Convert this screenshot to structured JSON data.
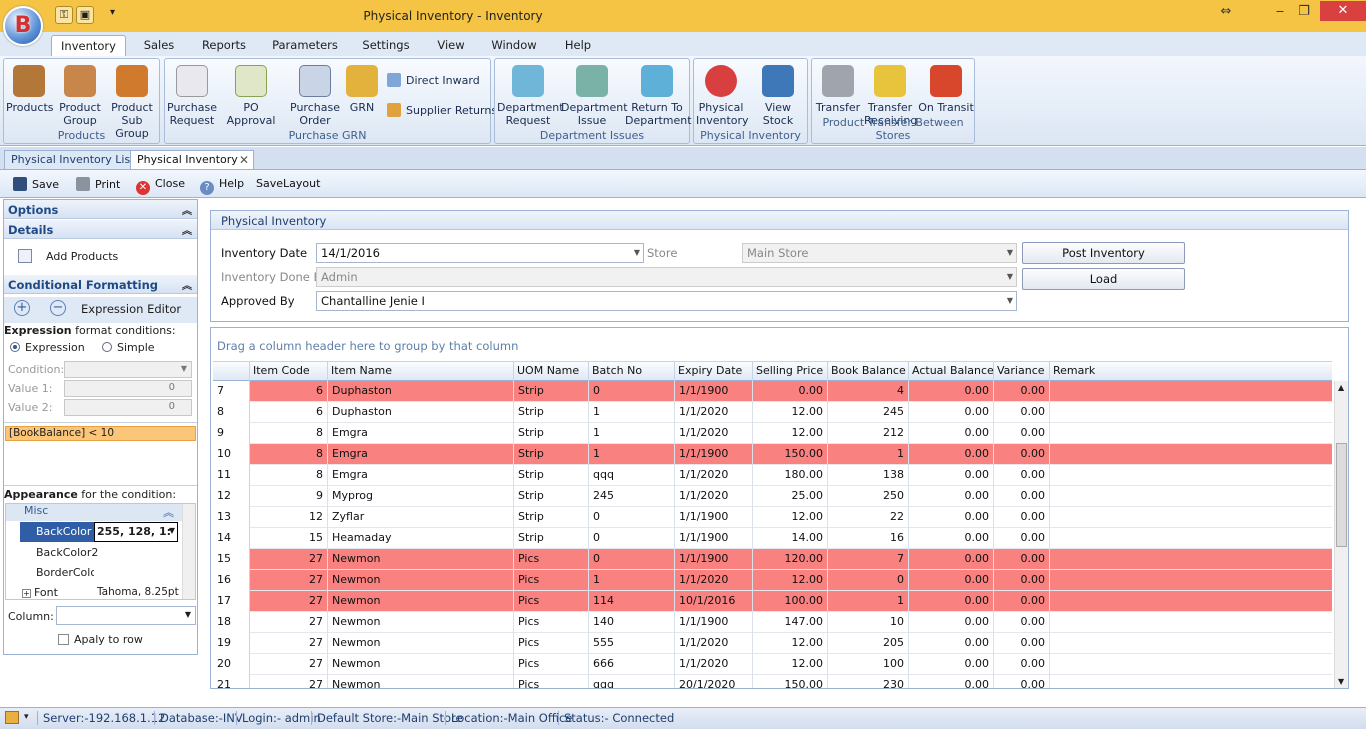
{
  "window": {
    "title": "Physical Inventory - Inventory",
    "restore_glyph": "⇔",
    "minimize_glyph": "‒",
    "maximize_glyph": "❐",
    "close_glyph": "✕"
  },
  "menu_tabs": [
    "Inventory",
    "Sales",
    "Reports",
    "Parameters",
    "Settings",
    "View",
    "Window",
    "Help"
  ],
  "ribbon": {
    "products_group": "Products",
    "products": "Products",
    "product_group": "Product\nGroup",
    "product_sub_group": "Product\nSub Group",
    "purchase_grn_group": "Purchase GRN",
    "purchase_request": "Purchase\nRequest",
    "po_approval": "PO Approval",
    "purchase_order": "Purchase\nOrder",
    "grn": "GRN",
    "direct_inward": "Direct Inward",
    "supplier_returns": "Supplier Returns",
    "department_issues_group": "Department Issues",
    "department_request": "Department\nRequest",
    "department_issue": "Department\nIssue",
    "return_to_department": "Return To\nDepartment",
    "physical_inventory_group": "Physical Inventory",
    "physical_inventory": "Physical\nInventory",
    "view_stock": "View Stock",
    "product_transfer_group": "Product Transfer Between Stores",
    "transfer": "Transfer",
    "transfer_receiving": "Transfer\nReceiving",
    "on_transit": "On Transit"
  },
  "doc_tabs": {
    "list": "Physical Inventory List",
    "active": "Physical Inventory",
    "close_glyph": "✕"
  },
  "toolbar": {
    "save": "Save",
    "print": "Print",
    "close": "Close",
    "help": "Help",
    "save_layout": "SaveLayout"
  },
  "left_panel": {
    "options": "Options",
    "details": "Details",
    "add_products": "Add Products",
    "conditional_formatting": "Conditional Formatting",
    "expression_editor": "Expression Editor",
    "expression_format_bold": "Expression",
    "expression_format_rest": " format conditions:",
    "radio_expression": "Expression",
    "radio_simple": "Simple",
    "condition_label": "Condition:",
    "value1_label": "Value 1:",
    "value1": "0",
    "value2_label": "Value 2:",
    "value2": "0",
    "condition_item": "[BookBalance] < 10",
    "appearance_bold": "Appearance",
    "appearance_rest": " for the condition:",
    "misc": "Misc",
    "prop_backcolor": "BackColor",
    "prop_backcolor_value": "255, 128, 1:",
    "prop_backcolor2": "BackColor2",
    "prop_bordercolor": "BorderColor",
    "prop_font": "Font",
    "prop_font_value": "Tahoma, 8.25pt",
    "column_label": "Column:",
    "apply_to_row": "Apaly to row"
  },
  "form": {
    "group_title": "Physical Inventory",
    "inventory_date_label": "Inventory Date",
    "inventory_date": "14/1/2016",
    "store_label": "Store",
    "store": "Main Store",
    "done_by_label": "Inventory Done By",
    "done_by": "Admin",
    "approved_by_label": "Approved By",
    "approved_by": "Chantalline Jenie I",
    "post_inventory": "Post Inventory",
    "load": "Load"
  },
  "grid": {
    "group_hint": "Drag a column header here to group by that column",
    "columns": [
      "Item Code",
      "Item Name",
      "UOM Name",
      "Batch No",
      "Expiry Date",
      "Selling Price",
      "Book Balance",
      "Actual Balance",
      "Variance",
      "Remark"
    ],
    "highlight_color": "#f98180",
    "rows": [
      {
        "n": "7",
        "code": "6",
        "name": "Duphaston",
        "uom": "Strip",
        "batch": "0",
        "expiry": "1/1/1900",
        "price": "0.00",
        "book": "4",
        "actual": "0.00",
        "variance": "0.00",
        "hl": true
      },
      {
        "n": "8",
        "code": "6",
        "name": "Duphaston",
        "uom": "Strip",
        "batch": "1",
        "expiry": "1/1/2020",
        "price": "12.00",
        "book": "245",
        "actual": "0.00",
        "variance": "0.00",
        "hl": false
      },
      {
        "n": "9",
        "code": "8",
        "name": "Emgra",
        "uom": "Strip",
        "batch": "1",
        "expiry": "1/1/2020",
        "price": "12.00",
        "book": "212",
        "actual": "0.00",
        "variance": "0.00",
        "hl": false
      },
      {
        "n": "10",
        "code": "8",
        "name": "Emgra",
        "uom": "Strip",
        "batch": "1",
        "expiry": "1/1/1900",
        "price": "150.00",
        "book": "1",
        "actual": "0.00",
        "variance": "0.00",
        "hl": true
      },
      {
        "n": "11",
        "code": "8",
        "name": "Emgra",
        "uom": "Strip",
        "batch": "qqq",
        "expiry": "1/1/2020",
        "price": "180.00",
        "book": "138",
        "actual": "0.00",
        "variance": "0.00",
        "hl": false
      },
      {
        "n": "12",
        "code": "9",
        "name": "Myprog",
        "uom": "Strip",
        "batch": "245",
        "expiry": "1/1/2020",
        "price": "25.00",
        "book": "250",
        "actual": "0.00",
        "variance": "0.00",
        "hl": false
      },
      {
        "n": "13",
        "code": "12",
        "name": "Zyflar",
        "uom": "Strip",
        "batch": "0",
        "expiry": "1/1/1900",
        "price": "12.00",
        "book": "22",
        "actual": "0.00",
        "variance": "0.00",
        "hl": false
      },
      {
        "n": "14",
        "code": "15",
        "name": "Heamaday",
        "uom": "Strip",
        "batch": "0",
        "expiry": "1/1/1900",
        "price": "14.00",
        "book": "16",
        "actual": "0.00",
        "variance": "0.00",
        "hl": false
      },
      {
        "n": "15",
        "code": "27",
        "name": "Newmon",
        "uom": "Pics",
        "batch": "0",
        "expiry": "1/1/1900",
        "price": "120.00",
        "book": "7",
        "actual": "0.00",
        "variance": "0.00",
        "hl": true
      },
      {
        "n": "16",
        "code": "27",
        "name": "Newmon",
        "uom": "Pics",
        "batch": "1",
        "expiry": "1/1/2020",
        "price": "12.00",
        "book": "0",
        "actual": "0.00",
        "variance": "0.00",
        "hl": true
      },
      {
        "n": "17",
        "code": "27",
        "name": "Newmon",
        "uom": "Pics",
        "batch": "114",
        "expiry": "10/1/2016",
        "price": "100.00",
        "book": "1",
        "actual": "0.00",
        "variance": "0.00",
        "hl": true
      },
      {
        "n": "18",
        "code": "27",
        "name": "Newmon",
        "uom": "Pics",
        "batch": "140",
        "expiry": "1/1/1900",
        "price": "147.00",
        "book": "10",
        "actual": "0.00",
        "variance": "0.00",
        "hl": false
      },
      {
        "n": "19",
        "code": "27",
        "name": "Newmon",
        "uom": "Pics",
        "batch": "555",
        "expiry": "1/1/2020",
        "price": "12.00",
        "book": "205",
        "actual": "0.00",
        "variance": "0.00",
        "hl": false
      },
      {
        "n": "20",
        "code": "27",
        "name": "Newmon",
        "uom": "Pics",
        "batch": "666",
        "expiry": "1/1/2020",
        "price": "12.00",
        "book": "100",
        "actual": "0.00",
        "variance": "0.00",
        "hl": false
      },
      {
        "n": "21",
        "code": "27",
        "name": "Newmon",
        "uom": "Pics",
        "batch": "qqq",
        "expiry": "20/1/2020",
        "price": "150.00",
        "book": "230",
        "actual": "0.00",
        "variance": "0.00",
        "hl": false
      }
    ]
  },
  "status": {
    "server": "Server:-192.168.1.12",
    "database": "Database:-INV",
    "login": "Login:- admin",
    "default_store": "Default Store:-Main Store",
    "location": "Location:-Main Office",
    "status": "Status:- Connected"
  }
}
